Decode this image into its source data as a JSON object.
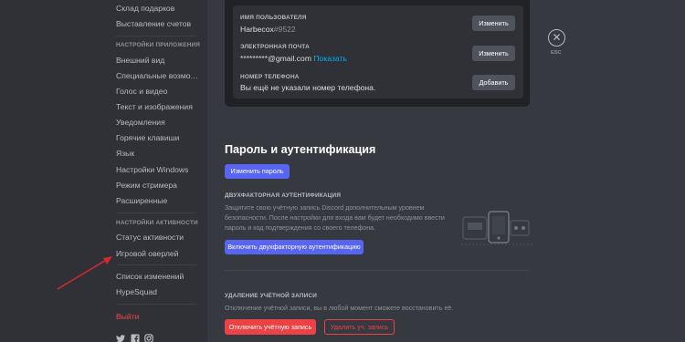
{
  "sidebar": {
    "items_top": [
      "Склад подарков",
      "Выставление счетов"
    ],
    "app_settings_header": "НАСТРОЙКИ ПРИЛОЖЕНИЯ",
    "app_items": [
      "Внешний вид",
      "Специальные возмож...",
      "Голос и видео",
      "Текст и изображения",
      "Уведомления",
      "Горячие клавиши",
      "Язык",
      "Настройки Windows",
      "Режим стримера",
      "Расширенные"
    ],
    "activity_header": "НАСТРОЙКИ АКТИВНОСТИ",
    "activity_items": [
      "Статус активности",
      "Игровой оверлей"
    ],
    "misc_items": [
      "Список изменений",
      "HypeSquad"
    ],
    "logout": "Выйти",
    "social_icons": [
      "twitter-icon",
      "facebook-icon",
      "instagram-icon"
    ]
  },
  "account": {
    "username_label": "ИМЯ ПОЛЬЗОВАТЕЛЯ",
    "username": "Harbecox",
    "discriminator": "#9522",
    "email_label": "ЭЛЕКТРОННАЯ ПОЧТА",
    "email": "*********@gmail.com",
    "email_show": "Показать",
    "phone_label": "НОМЕР ТЕЛЕФОНА",
    "phone": "Вы ещё не указали номер телефона.",
    "edit_button": "Изменить",
    "add_button": "Добавить"
  },
  "close": {
    "label": "ESC"
  },
  "security": {
    "title": "Пароль и аутентификация",
    "change_password": "Изменить пароль",
    "twofa_label": "ДВУХФАКТОРНАЯ АУТЕНТИФИКАЦИЯ",
    "twofa_desc": "Защитите свою учётную запись Discord дополнительным уровнем безопасности. После настройки для входа вам будет необходимо ввести пароль и код подтверждения со своего телефона.",
    "twofa_button": "Включить двухфакторную аутентификацию"
  },
  "delete": {
    "label": "УДАЛЕНИЕ УЧЁТНОЙ ЗАПИСИ",
    "desc": "Отключение учётной записи, вы в любой момент сможете восстановить её.",
    "disable_button": "Отключить учётную запись",
    "delete_button": "Удалить уч. запись"
  },
  "colors": {
    "sidebar_bg": "#2f3136",
    "content_bg": "#36393f",
    "brand": "#5865f2",
    "danger": "#ed4245",
    "annotation_arrow": "#d42a2a"
  }
}
